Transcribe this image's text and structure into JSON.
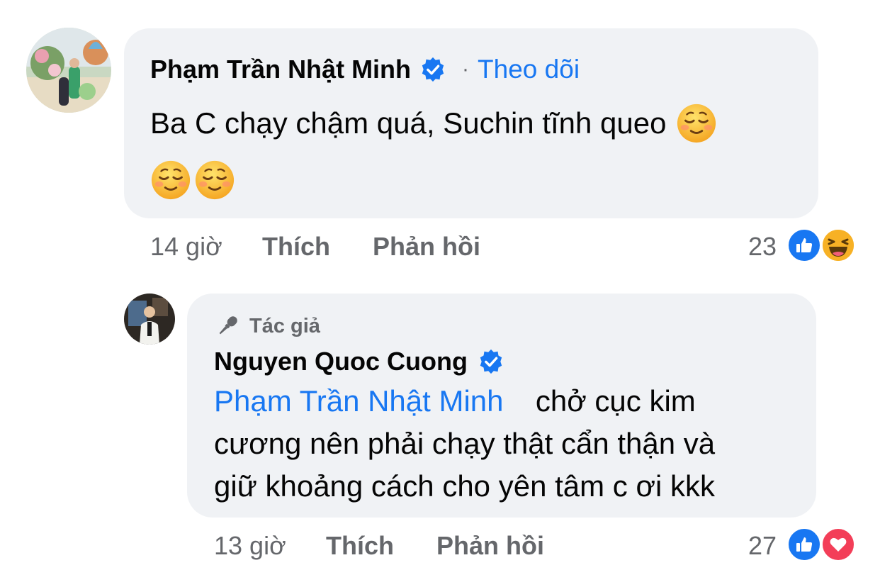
{
  "comments": [
    {
      "author": "Phạm Trần Nhật Minh",
      "follow_dot": "·",
      "follow_label": "Theo dõi",
      "text_line1": "Ba C chạy chậm quá, Suchin tĩnh queo",
      "emoji_icon": "smiling-face-icon",
      "time": "14 giờ",
      "like_label": "Thích",
      "reply_label": "Phản hồi",
      "reaction_count": "23",
      "reactions": [
        "like-icon",
        "haha-icon"
      ]
    },
    {
      "author_badge": "Tác giả",
      "author": "Nguyen Quoc Cuong",
      "mention": "Phạm Trần Nhật Minh",
      "text_line1": "chở cục kim",
      "text_line2": "cương nên phải chạy thật cẩn thận và",
      "text_line3": "giữ khoảng cách cho yên tâm c ơi kkk",
      "time": "13 giờ",
      "like_label": "Thích",
      "reply_label": "Phản hồi",
      "reaction_count": "27",
      "reactions": [
        "like-icon",
        "love-icon"
      ]
    }
  ],
  "colors": {
    "bubble": "#f0f2f5",
    "link": "#1877f2",
    "meta": "#65676b",
    "love": "#f33e58",
    "haha": "#f7b125"
  }
}
